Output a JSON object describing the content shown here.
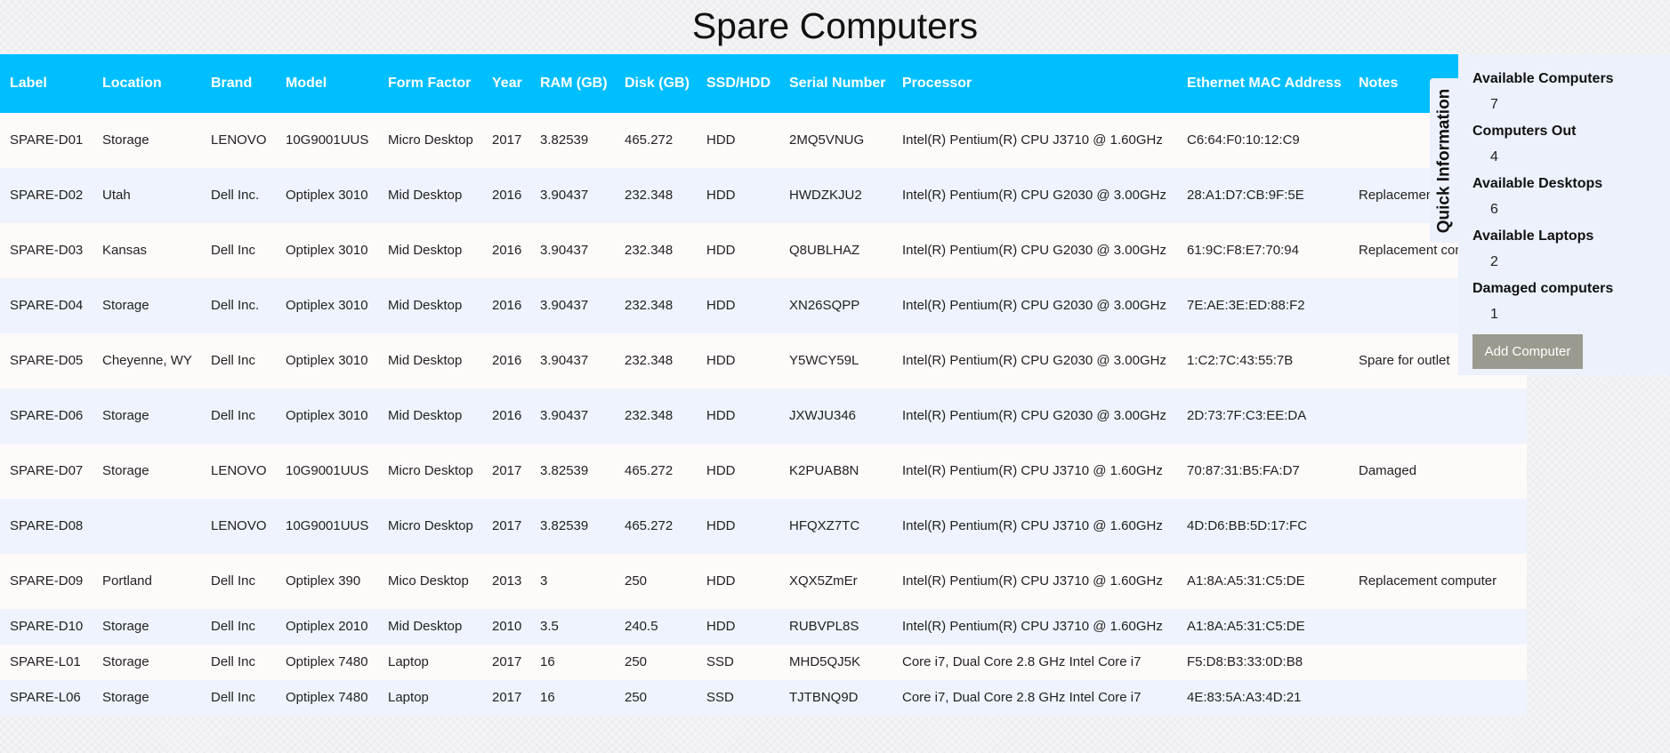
{
  "page": {
    "title": "Spare Computers"
  },
  "table": {
    "headers": [
      "Label",
      "Location",
      "Brand",
      "Model",
      "Form Factor",
      "Year",
      "RAM (GB)",
      "Disk (GB)",
      "SSD/HDD",
      "Serial Number",
      "Processor",
      "Ethernet MAC Address",
      "Notes"
    ],
    "rows": [
      [
        "SPARE-D01",
        "Storage",
        "LENOVO",
        "10G9001UUS",
        "Micro Desktop",
        "2017",
        "3.82539",
        "465.272",
        "HDD",
        "2MQ5VNUG",
        "Intel(R) Pentium(R) CPU J3710 @ 1.60GHz",
        "C6:64:F0:10:12:C9",
        ""
      ],
      [
        "SPARE-D02",
        "Utah",
        "Dell Inc.",
        "Optiplex 3010",
        "Mid Desktop",
        "2016",
        "3.90437",
        "232.348",
        "HDD",
        "HWDZKJU2",
        "Intel(R) Pentium(R) CPU G2030 @ 3.00GHz",
        "28:A1:D7:CB:9F:5E",
        "Replacement computer"
      ],
      [
        "SPARE-D03",
        "Kansas",
        "Dell Inc",
        "Optiplex 3010",
        "Mid Desktop",
        "2016",
        "3.90437",
        "232.348",
        "HDD",
        "Q8UBLHAZ",
        "Intel(R) Pentium(R) CPU G2030 @ 3.00GHz",
        "61:9C:F8:E7:70:94",
        "Replacement computer"
      ],
      [
        "SPARE-D04",
        "Storage",
        "Dell Inc.",
        "Optiplex 3010",
        "Mid Desktop",
        "2016",
        "3.90437",
        "232.348",
        "HDD",
        "XN26SQPP",
        "Intel(R) Pentium(R) CPU G2030 @ 3.00GHz",
        "7E:AE:3E:ED:88:F2",
        ""
      ],
      [
        "SPARE-D05",
        "Cheyenne, WY",
        "Dell Inc",
        "Optiplex 3010",
        "Mid Desktop",
        "2016",
        "3.90437",
        "232.348",
        "HDD",
        "Y5WCY59L",
        "Intel(R) Pentium(R) CPU G2030 @ 3.00GHz",
        "1:C2:7C:43:55:7B",
        "Spare for outlet"
      ],
      [
        "SPARE-D06",
        "Storage",
        "Dell Inc",
        "Optiplex 3010",
        "Mid Desktop",
        "2016",
        "3.90437",
        "232.348",
        "HDD",
        "JXWJU346",
        "Intel(R) Pentium(R) CPU G2030 @ 3.00GHz",
        "2D:73:7F:C3:EE:DA",
        ""
      ],
      [
        "SPARE-D07",
        "Storage",
        "LENOVO",
        "10G9001UUS",
        "Micro Desktop",
        "2017",
        "3.82539",
        "465.272",
        "HDD",
        "K2PUAB8N",
        "Intel(R) Pentium(R) CPU J3710 @ 1.60GHz",
        "70:87:31:B5:FA:D7",
        "Damaged"
      ],
      [
        "SPARE-D08",
        "",
        "LENOVO",
        "10G9001UUS",
        "Micro Desktop",
        "2017",
        "3.82539",
        "465.272",
        "HDD",
        "HFQXZ7TC",
        "Intel(R) Pentium(R) CPU J3710 @ 1.60GHz",
        "4D:D6:BB:5D:17:FC",
        ""
      ],
      [
        "SPARE-D09",
        "Portland",
        "Dell Inc",
        "Optiplex 390",
        "Mico Desktop",
        "2013",
        "3",
        "250",
        "HDD",
        "XQX5ZmEr",
        "Intel(R) Pentium(R) CPU J3710 @ 1.60GHz",
        "A1:8A:A5:31:C5:DE",
        "Replacement computer"
      ],
      [
        "SPARE-D10",
        "Storage",
        "Dell Inc",
        "Optiplex 2010",
        "Mid Desktop",
        "2010",
        "3.5",
        "240.5",
        "HDD",
        "RUBVPL8S",
        "Intel(R) Pentium(R) CPU J3710 @ 1.60GHz",
        "A1:8A:A5:31:C5:DE",
        ""
      ],
      [
        "SPARE-L01",
        "Storage",
        "Dell Inc",
        "Optiplex 7480",
        "Laptop",
        "2017",
        "16",
        "250",
        "SSD",
        "MHD5QJ5K",
        "Core i7, Dual Core 2.8 GHz Intel Core i7",
        "F5:D8:B3:33:0D:B8",
        ""
      ],
      [
        "SPARE-L06",
        "Storage",
        "Dell Inc",
        "Optiplex 7480",
        "Laptop",
        "2017",
        "16",
        "250",
        "SSD",
        "TJTBNQ9D",
        "Core i7, Dual Core 2.8 GHz Intel Core i7",
        "4E:83:5A:A3:4D:21",
        ""
      ]
    ]
  },
  "quick_info": {
    "tab_label": "Quick Information",
    "stats": [
      {
        "label": "Available Computers",
        "value": "7"
      },
      {
        "label": "Computers Out",
        "value": "4"
      },
      {
        "label": "Available Desktops",
        "value": "6"
      },
      {
        "label": "Available Laptops",
        "value": "2"
      },
      {
        "label": "Damaged computers",
        "value": "1"
      }
    ],
    "add_button_label": "Add Computer"
  },
  "colors": {
    "header_bg": "#00bfff",
    "row_odd": "#fffafa",
    "row_even": "#eef3fd",
    "panel_bg": "#ecf1fc",
    "button_bg": "#9a9a8f"
  }
}
